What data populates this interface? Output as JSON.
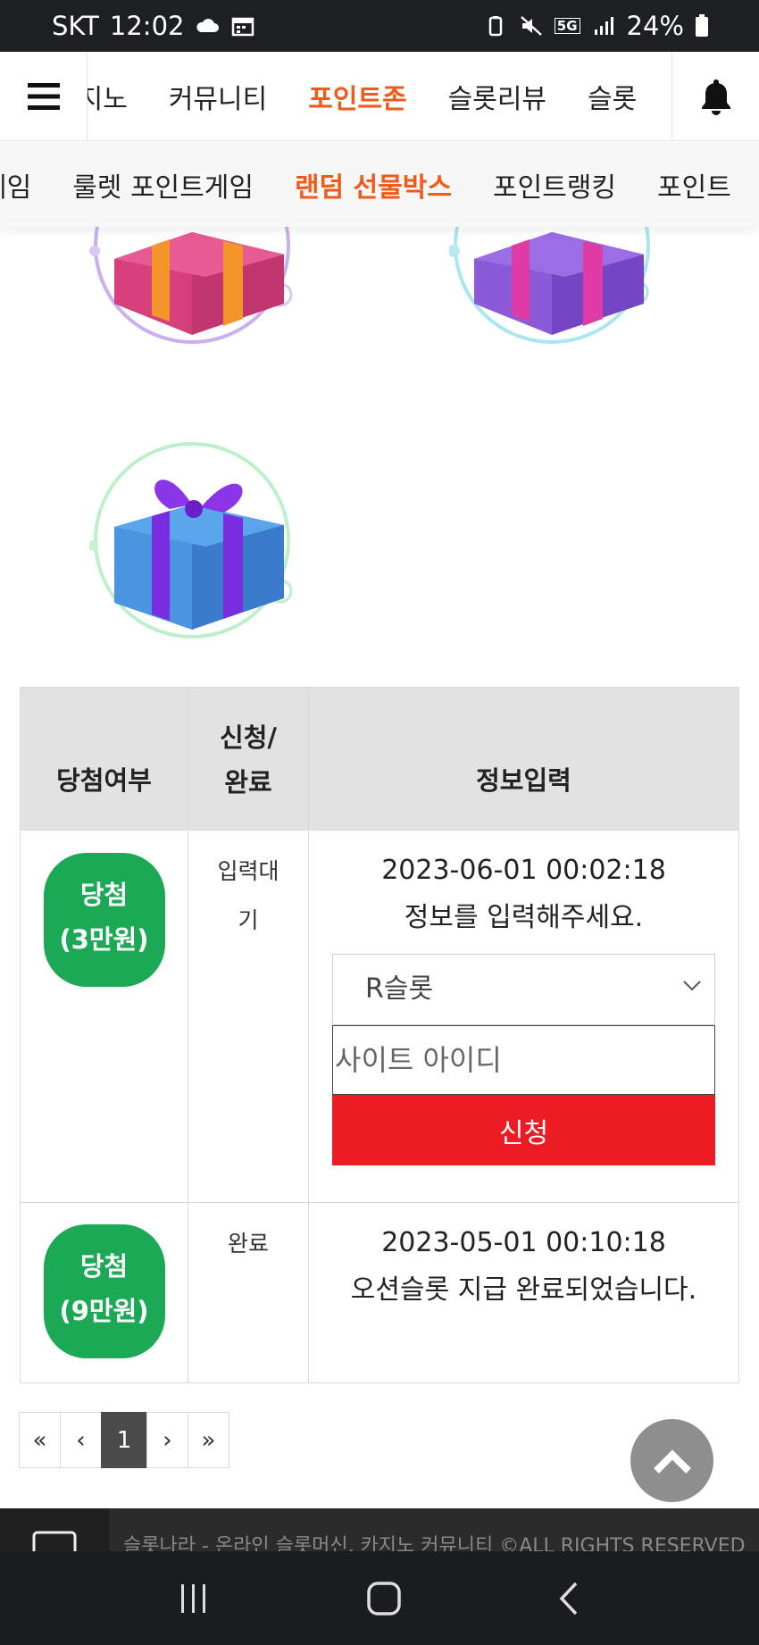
{
  "status_bar": {
    "carrier": "SKT",
    "time": "12:02",
    "network": "5G",
    "battery": "24%"
  },
  "top_nav": {
    "items": [
      {
        "label": "카지노"
      },
      {
        "label": "커뮤니티"
      },
      {
        "label": "포인트존",
        "active": true
      },
      {
        "label": "슬롯리뷰"
      },
      {
        "label": "슬롯"
      }
    ]
  },
  "sub_nav": {
    "items": [
      {
        "label": "게임"
      },
      {
        "label": "룰렛 포인트게임"
      },
      {
        "label": "랜덤 선물박스",
        "active": true
      },
      {
        "label": "포인트랭킹"
      },
      {
        "label": "포인트"
      }
    ]
  },
  "gifts": [
    {
      "name": "pink-gift-box"
    },
    {
      "name": "purple-gift-box"
    },
    {
      "name": "blue-gift-box"
    }
  ],
  "table": {
    "headers": {
      "result": "당첨여부",
      "status_line1": "신청/",
      "status_line2": "완료",
      "info": "정보입력"
    },
    "rows": [
      {
        "badge_line1": "당첨",
        "badge_line2": "(3만원)",
        "status_line1": "입력대",
        "status_line2": "기",
        "datetime": "2023-06-01 00:02:18",
        "message": "정보를 입력해주세요.",
        "select_value": "R슬롯",
        "input_placeholder": "사이트 아이디",
        "button_label": "신청"
      },
      {
        "badge_line1": "당첨",
        "badge_line2": "(9만원)",
        "status_line1": "완료",
        "datetime": "2023-05-01 00:10:18",
        "message": "오션슬롯 지급 완료되었습니다."
      }
    ]
  },
  "pagination": {
    "first": "«",
    "prev": "‹",
    "current": "1",
    "next": "›",
    "last": "»"
  },
  "footer": {
    "text": "슬롯나라 - 온라인 슬롯머신, 카지노 커뮤니티 ©ALL RIGHTS RESERVED"
  },
  "colors": {
    "accent": "#f05a1a",
    "badge_green": "#1ca956",
    "button_red": "#ec1c24"
  }
}
